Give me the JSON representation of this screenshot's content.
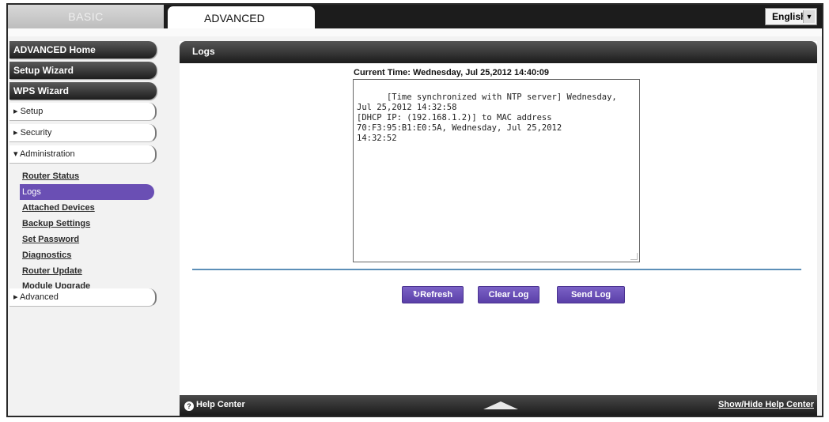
{
  "tabs": {
    "basic": "BASIC",
    "advanced": "ADVANCED"
  },
  "language": {
    "selected": "English"
  },
  "sidebar": {
    "primary": [
      "ADVANCED Home",
      "Setup Wizard",
      "WPS Wizard"
    ],
    "sections": [
      "▸ Setup",
      "▸ Security",
      "▾ Administration"
    ],
    "admin_links": [
      "Router Status",
      "Logs",
      "Attached Devices",
      "Backup Settings",
      "Set Password",
      "Diagnostics",
      "Router Update",
      "Module Upgrade"
    ],
    "advanced": "▸ Advanced"
  },
  "main": {
    "title": "Logs",
    "current_time": "Current Time: Wednesday, Jul 25,2012 14:40:09",
    "log_text": "[Time synchronized with NTP server] Wednesday,\nJul 25,2012 14:32:58\n[DHCP IP: (192.168.1.2)] to MAC address\n70:F3:95:B1:E0:5A, Wednesday, Jul 25,2012\n14:32:52",
    "buttons": {
      "refresh": "↻Refresh",
      "clear": "Clear Log",
      "send": "Send Log"
    }
  },
  "help": {
    "center": "Help Center",
    "toggle": "Show/Hide Help Center"
  },
  "colors": {
    "accent": "#6a4fb4",
    "divider": "#5c8fb8",
    "header": "#1c1c1c"
  }
}
